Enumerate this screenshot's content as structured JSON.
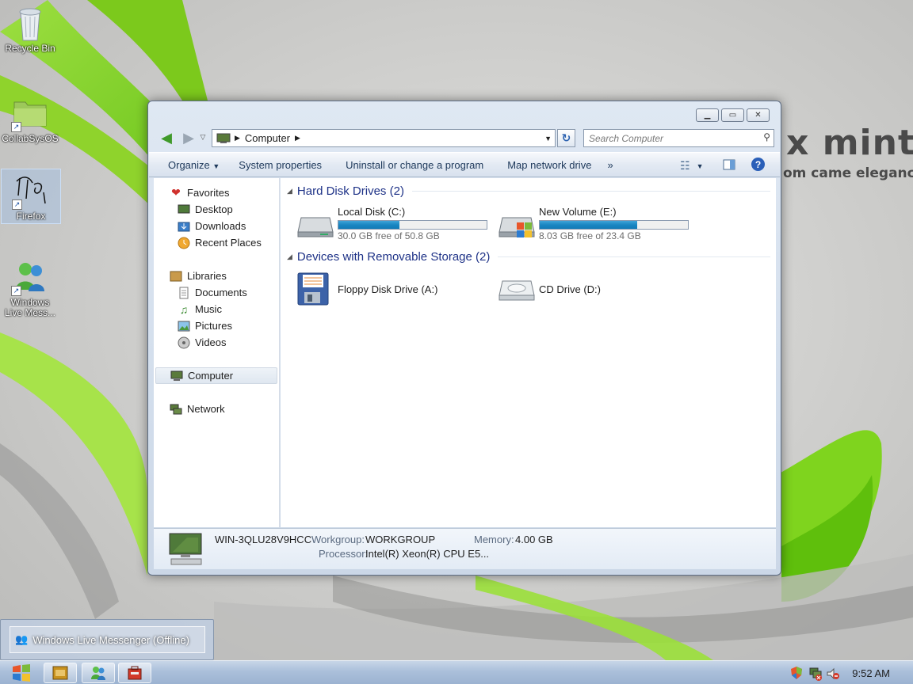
{
  "desktop": {
    "brand_line1": "x mint",
    "brand_line2": "om came elegance",
    "icons": [
      {
        "label": "Recycle Bin"
      },
      {
        "label": "CollabSysOS"
      },
      {
        "label": "Firefox"
      },
      {
        "label_line1": "Windows",
        "label_line2": "Live Mess..."
      }
    ]
  },
  "window": {
    "address": {
      "root_label": "Computer"
    },
    "search_placeholder": "Search Computer",
    "toolbar": {
      "organize": "Organize",
      "system_properties": "System properties",
      "uninstall": "Uninstall or change a program",
      "map_drive": "Map network drive",
      "more": "»"
    },
    "nav": {
      "favorites": "Favorites",
      "desktop": "Desktop",
      "downloads": "Downloads",
      "recent": "Recent Places",
      "libraries": "Libraries",
      "documents": "Documents",
      "music": "Music",
      "pictures": "Pictures",
      "videos": "Videos",
      "computer": "Computer",
      "network": "Network"
    },
    "groups": {
      "hdd": "Hard Disk Drives (2)",
      "removable": "Devices with Removable Storage (2)"
    },
    "drives": [
      {
        "name": "Local Disk (C:)",
        "free": "30.0 GB free of 50.8 GB",
        "used_fraction": 0.41
      },
      {
        "name": "New Volume (E:)",
        "free": "8.03 GB free of 23.4 GB",
        "used_fraction": 0.66
      }
    ],
    "removable": [
      {
        "name": "Floppy Disk Drive (A:)"
      },
      {
        "name": "CD Drive (D:)"
      }
    ],
    "details": {
      "computer_name": "WIN-3QLU28V9HCC",
      "workgroup_label": "Workgroup:",
      "workgroup_value": "WORKGROUP",
      "memory_label": "Memory:",
      "memory_value": "4.00 GB",
      "processor_label": "Processor:",
      "processor_value": "Intel(R) Xeon(R) CPU E5..."
    }
  },
  "taskbar": {
    "thumbnail_title": "Windows Live Messenger (Offline)",
    "clock": "9:52 AM"
  },
  "colors": {
    "accent_green": "#7fd41e",
    "group_header": "#1e3287",
    "bar_fill": "#1a86c2"
  }
}
